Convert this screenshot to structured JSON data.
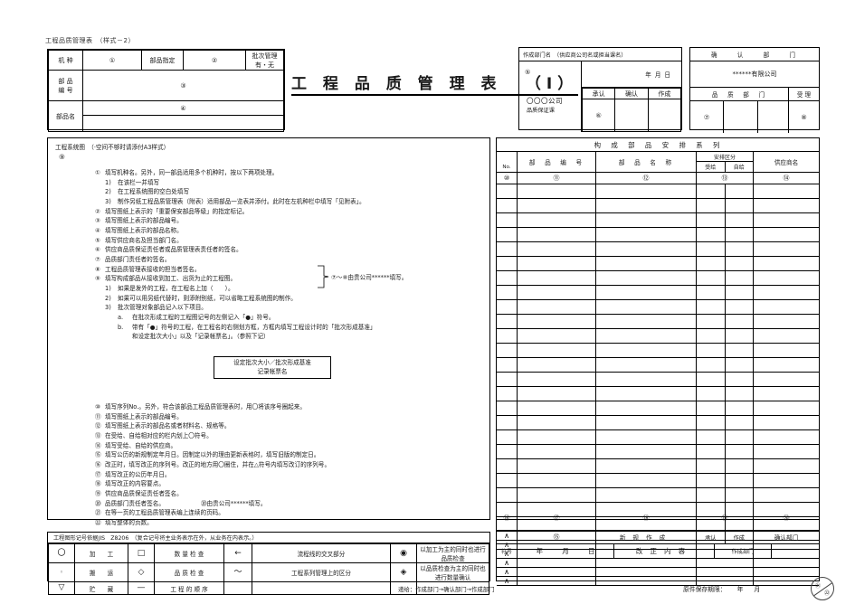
{
  "document": {
    "form_caption": "工程品质管理表　（样式－2）",
    "title": "工 程 品 质 管 理 表 　（Ⅰ）"
  },
  "machine_table": {
    "label_machine": "机 种",
    "mark_1": "①",
    "label_part_designation": "部品指定",
    "mark_2": "②",
    "label_lot_control": "批次管理",
    "label_lot_control_sub": "有・无",
    "label_part_no": "部 品",
    "label_part_no_sub": "编 号",
    "mark_3": "③",
    "label_part_name": "部品名",
    "mark_4": "④"
  },
  "maker_block": {
    "header": "作成部门名　（供应商公司名或担当课名）",
    "mark_5": "⑤",
    "date_y": "年",
    "date_m": "月",
    "date_d": "日",
    "company": "〇〇〇公司",
    "company_sub": "品质保证课",
    "col_approve": "承认",
    "col_confirm": "确认",
    "col_create": "作成",
    "mark_6": "⑥"
  },
  "confirm_block": {
    "header": "确　　认　　部　　门",
    "company": "******有限公司",
    "col_quality_dept": "品　质　部　门",
    "col_receive": "受 理",
    "mark_7": "⑦",
    "mark_8": "⑧"
  },
  "flow_panel": {
    "caption": "工程系统图　（·空间不够时请添付A3样式）",
    "mark_9": "⑨"
  },
  "instructions_top": [
    {
      "num": "①",
      "text": "填写机种名。另外，同一部品适用多个机种时，按以下两项处理。"
    },
    {
      "num": "1)",
      "level": 1,
      "text": "在该栏一并填写"
    },
    {
      "num": "2)",
      "level": 1,
      "text": "在工程系统图的空白处填写"
    },
    {
      "num": "3)",
      "level": 1,
      "text": "制作另纸工程品质管理表（附表）适用部品一览表并添付。此时在左机种栏中填写「见附表」。"
    },
    {
      "num": "②",
      "text": "填写图纸上表示的「重要保安部品等级」的指定标记。"
    },
    {
      "num": "③",
      "text": "填写图纸上表示的部品编号。"
    },
    {
      "num": "④",
      "text": "填写图纸上表示的部品名称。"
    },
    {
      "num": "⑤",
      "text": "填写供应商名及担当部门名。"
    },
    {
      "num": "⑥",
      "text": "供应商品质保证责任者或品质管理表责任者的签名。"
    },
    {
      "num": "⑦",
      "text": "品质部门责任者的签名。"
    },
    {
      "num": "⑧",
      "text": "工程品质管理表接收的担当者签名。"
    },
    {
      "num": "⑨",
      "text": "填写构成部品从接收到加工、出货为止的工程图。"
    },
    {
      "num": "1)",
      "level": 1,
      "text": "如果是发外的工程，在工程名上加（　　）。"
    },
    {
      "num": "2)",
      "level": 1,
      "text": "如果可以用另纸代替时，则添附别纸，可以省略工程系统图的制作。"
    },
    {
      "num": "3)",
      "level": 1,
      "text": "批次管理对象部品记入以下项目。"
    },
    {
      "num": "a.",
      "level": 2,
      "text": "在批次形成工程的工程图记号的左侧记入「●」符号。"
    },
    {
      "num": "b.",
      "level": 2,
      "text": "带有「●」符号的工程，在工程名的右侧划方框，方框内填写工程设计时的「批次形成基准」"
    },
    {
      "num": "",
      "level": 3,
      "text": "和设定批次大小」以及「记录帐票名」。（参照下记）"
    }
  ],
  "bracket_note": "⑦～⑧由贵公司******填写。",
  "lot_box": {
    "line1": "设定批次大小／批次形成基准",
    "line2": "记录帐票名"
  },
  "instructions_bottom": [
    {
      "num": "⑩",
      "text": "填写序列No.。另外，符合该部品工程品质管理表时，用〇将该序号圈起来。"
    },
    {
      "num": "⑪",
      "text": "填写图纸上表示的部品编号。"
    },
    {
      "num": "⑫",
      "text": "填写图纸上表示的部品名或者材料名、规格等。"
    },
    {
      "num": "⑬",
      "text": "在受给、自给相对应的栏内划上〇符号。"
    },
    {
      "num": "⑭",
      "text": "填写受给、自给的供应商。"
    },
    {
      "num": "⑮",
      "text": "填写公历的新规制定年月日。因制定以外的理由更新表格时，填写旧版的制定日。"
    },
    {
      "num": "⑯",
      "text": "改正时，填写改正的序列号。改正的地方用〇圈住，并在△符号内填写改订的序列号。"
    },
    {
      "num": "⑰",
      "text": "填写改正的公历年月日。"
    },
    {
      "num": "⑱",
      "text": "填写改正的内容要点。"
    },
    {
      "num": "⑲",
      "text": "供应商品质保证责任者签名。"
    },
    {
      "num": "⑳",
      "text": "品质部门责任者签名。",
      "note": "⑳由贵公司******填写。"
    },
    {
      "num": "㉑",
      "text": "在等一页的工程品质管理表编上连续的页码。"
    },
    {
      "num": "㉒",
      "text": "填写整体的页数。"
    }
  ],
  "legend": {
    "header": "工程图形记号依据JIS　Z8206　（复合记号将主业务表示在外，从业务在内表示。）",
    "rows": [
      {
        "sym1": "circle",
        "txt1": "加　　工",
        "sym2": "square",
        "txt2": "数 量 检 查",
        "sym3": "arrow",
        "txt3": "流程线的交叉部分",
        "sym4": "circle-in-circle",
        "txt4": "以加工为主的同时也进行品质检查"
      },
      {
        "sym1": "dot",
        "txt1": "搬　　运",
        "sym2": "diamond",
        "txt2": "品 质 检 查",
        "sym3": "wave",
        "txt3": "工程系列管理上的区分",
        "sym4": "diamond-in-circle",
        "txt4": "以品质检查为主的同时也进行数量确认"
      },
      {
        "sym1": "triangle",
        "txt1": "贮　　藏",
        "sym2": "line",
        "txt2": "工 程 的 顺 序",
        "sym3": "",
        "txt3": "",
        "sym4": "",
        "txt4": ""
      }
    ]
  },
  "route_note": "递给：作成部门→确认部门→作成部门",
  "parts_table": {
    "group_header": "构　成　部　品　安　排　系　列",
    "col_no": "No.",
    "col_part_no": "部　品　编　号",
    "col_part_name": "部　品　名　称",
    "col_supply_type": "安排区分",
    "col_supply_receive": "受给",
    "col_supply_self": "自给",
    "col_supplier": "供应商名",
    "mark_10": "⑩",
    "mark_11": "⑪",
    "mark_12": "⑫",
    "mark_13": "⑬",
    "mark_14": "⑭",
    "row_count": 24
  },
  "revision_table": {
    "mark_16": "⑯",
    "mark_17": "⑰",
    "mark_18": "⑱",
    "mark_19": "⑲",
    "mark_20": "⑳",
    "mark_15": "⑮",
    "col_symbol": "符号",
    "col_year": "年",
    "col_month": "月",
    "col_day": "日",
    "col_new": "新",
    "col_rule": "规",
    "col_make": "作",
    "col_made": "成",
    "rev_y": "改",
    "rev_z": "正",
    "rev_n": "内",
    "rev_c": "容",
    "col_approve": "承认",
    "col_create": "作成",
    "col_create_dept": "作成部门",
    "col_confirm_dept": "确认部门",
    "zigzag_rows": 6
  },
  "footer": {
    "retention": "原件保存期限：",
    "retention_y": "年",
    "retention_m": "月",
    "page_mark": "㉑",
    "page_total_mark": "㉒"
  }
}
